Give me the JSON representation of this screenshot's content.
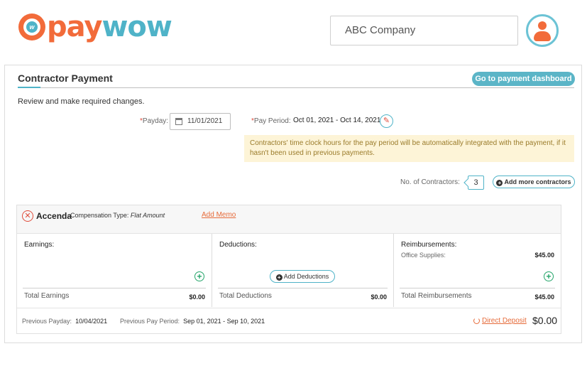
{
  "brand": {
    "pay": "pay",
    "wow": "wow",
    "mark_letter": "w"
  },
  "header": {
    "company": "ABC Company"
  },
  "card": {
    "title": "Contractor Payment",
    "dashboard_button": "Go to payment dashboard",
    "review_text": "Review and make required changes.",
    "required_marker": "*",
    "payday_label": "Payday:",
    "payday_value": "11/01/2021",
    "pay_period_label": "Pay Period:",
    "pay_period_value": "Oct 01, 2021 - Oct 14, 2021",
    "notice": "Contractors' time clock hours for the pay period will be automatically integrated with the payment, if it hasn't been used in previous payments.",
    "contractors_label": "No. of Contractors:",
    "contractors_count": "3",
    "add_contractors": "Add more contractors"
  },
  "entry": {
    "name": "Accenda",
    "compensation_label": "Compensation Type:",
    "compensation_value": "Flat Amount",
    "add_memo": "Add Memo",
    "earnings": {
      "title": "Earnings:",
      "total_label": "Total Earnings",
      "total_value": "$0.00"
    },
    "deductions": {
      "title": "Deductions:",
      "add_label": "Add Deductions",
      "total_label": "Total Deductions",
      "total_value": "$0.00"
    },
    "reimbursements": {
      "title": "Reimbursements:",
      "item_label": "Office Supplies:",
      "item_value": "$45.00",
      "total_label": "Total Reimbursements",
      "total_value": "$45.00"
    },
    "previous_payday_label": "Previous Payday:",
    "previous_payday_value": "10/04/2021",
    "previous_period_label": "Previous Pay Period:",
    "previous_period_value": "Sep 01, 2021 - Sep 10, 2021",
    "payment_method": "Direct Deposit",
    "net_amount": "$0.00"
  },
  "icons": {
    "calendar": "calendar-icon",
    "edit": "pencil-icon",
    "remove": "close-circle-icon",
    "add": "plus-circle-icon",
    "refresh": "refresh-icon",
    "user": "user-avatar-icon"
  },
  "colors": {
    "brand_orange": "#f26b3a",
    "brand_teal": "#4fb3c8",
    "notice_bg": "#fdf4d7",
    "add_green": "#25a56a"
  }
}
